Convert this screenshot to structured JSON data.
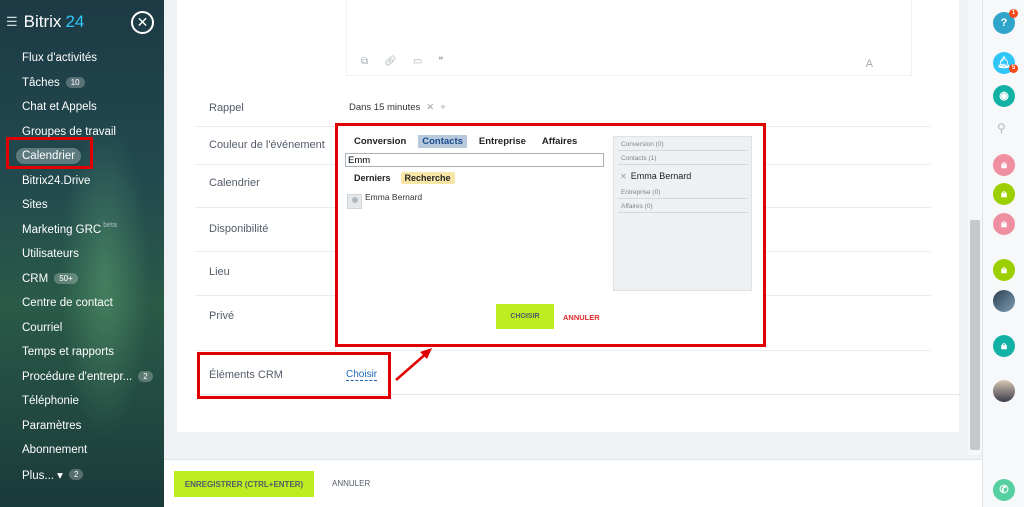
{
  "sidebar": {
    "brand_name": "Bitrix",
    "brand_num": "24",
    "items": [
      {
        "label": "Flux d'activités"
      },
      {
        "label": "Tâches",
        "counter": "10"
      },
      {
        "label": "Chat et Appels"
      },
      {
        "label": "Groupes de travail"
      },
      {
        "label": "Calendrier"
      },
      {
        "label": "Bitrix24.Drive"
      },
      {
        "label": "Sites"
      },
      {
        "label": "Marketing GRC",
        "sup": "beta"
      },
      {
        "label": "Utilisateurs"
      },
      {
        "label": "CRM",
        "counter": "50+"
      },
      {
        "label": "Centre de contact"
      },
      {
        "label": "Courriel"
      },
      {
        "label": "Temps et rapports"
      },
      {
        "label": "Procédure d'entrepr...",
        "counter": "2"
      },
      {
        "label": "Téléphonie"
      },
      {
        "label": "Paramètres"
      },
      {
        "label": "Abonnement"
      },
      {
        "label": "Plus... ▾",
        "counter": "2"
      }
    ]
  },
  "form": {
    "rappel_label": "Rappel",
    "rappel_value": "Dans 15 minutes",
    "couleur_label": "Couleur de l'événement",
    "calendrier_label": "Calendrier",
    "disponibilite_label": "Disponibilité",
    "lieu_label": "Lieu",
    "prive_label": "Privé",
    "crm_label": "Éléments CRM",
    "crm_choose": "Choisir"
  },
  "dialog": {
    "tabs": [
      "Conversion",
      "Contacts",
      "Entreprise",
      "Affaires"
    ],
    "active_tab": "Contacts",
    "search_value": "Emm",
    "subtabs": [
      "Derniers",
      "Recherche"
    ],
    "active_subtab": "Recherche",
    "result_name": "Emma Bernard",
    "panel": {
      "conversion": "Conversion (0)",
      "contacts": "Contacts (1)",
      "selected": "Emma Bernard",
      "entreprise": "Entreprise (0)",
      "affaires": "Affaires (0)"
    },
    "choose_button": "CHOISIR",
    "cancel_button": "ANNULER"
  },
  "footer": {
    "save_button": "ENREGISTRER (CTRL+ENTER)",
    "cancel_button": "ANNULER"
  },
  "rightbar": {
    "help_badge": "1",
    "notif_badge": "5"
  },
  "colors": {
    "accent_green": "#bbed21",
    "highlight_red": "#e10000",
    "link_blue": "#2067b0",
    "brand_blue": "#2fc6f6"
  }
}
